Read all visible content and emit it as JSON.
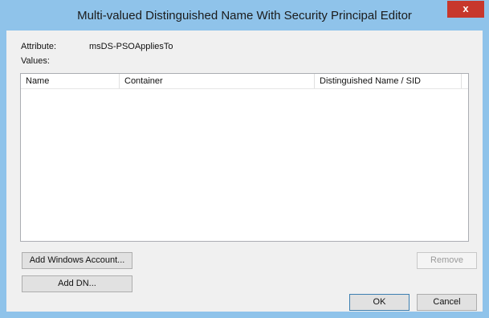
{
  "window": {
    "title": "Multi-valued Distinguished Name With Security Principal Editor",
    "close_glyph": "x"
  },
  "attribute": {
    "label": "Attribute:",
    "value": "msDS-PSOAppliesTo"
  },
  "values_label": "Values:",
  "list": {
    "columns": [
      "Name",
      "Container",
      "Distinguished Name / SID"
    ],
    "rows": []
  },
  "buttons": {
    "add_windows_account": "Add Windows Account...",
    "add_dn": "Add DN...",
    "remove": "Remove",
    "ok": "OK",
    "cancel": "Cancel"
  },
  "colors": {
    "title_bar": "#8fc3ea",
    "close": "#c7372c"
  }
}
